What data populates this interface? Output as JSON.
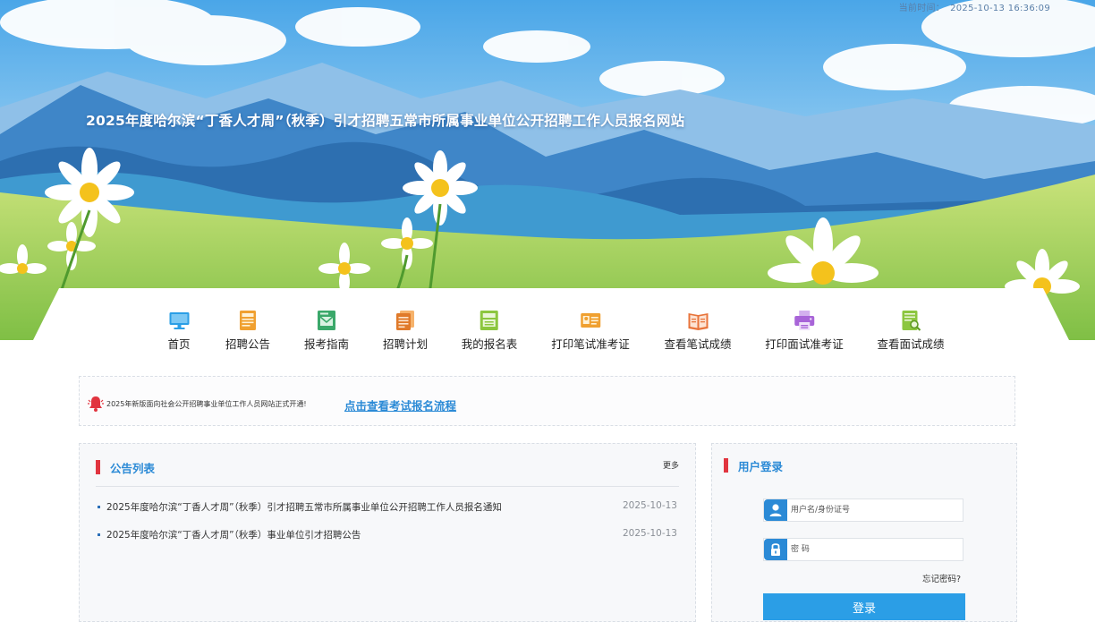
{
  "header": {
    "time_label": "当前时间：",
    "time_value": "2025-10-13 16:36:09",
    "site_title": "2025年度哈尔滨“丁香人才周”（秋季）引才招聘五常市所属事业单位公开招聘工作人员报名网站"
  },
  "nav": {
    "items": [
      {
        "label": "首页",
        "icon": "monitor-icon",
        "color": "#2b9ee6"
      },
      {
        "label": "招聘公告",
        "icon": "document-icon",
        "color": "#f0a030"
      },
      {
        "label": "报考指南",
        "icon": "mail-icon",
        "color": "#3aa86a"
      },
      {
        "label": "招聘计划",
        "icon": "files-icon",
        "color": "#e07a2a"
      },
      {
        "label": "我的报名表",
        "icon": "form-icon",
        "color": "#8cc63f"
      },
      {
        "label": "打印笔试准考证",
        "icon": "id-card-icon",
        "color": "#f0a030"
      },
      {
        "label": "查看笔试成绩",
        "icon": "book-icon",
        "color": "#e8743b"
      },
      {
        "label": "打印面试准考证",
        "icon": "printer-icon",
        "color": "#a864d8"
      },
      {
        "label": "查看面试成绩",
        "icon": "search-doc-icon",
        "color": "#8cc63f"
      }
    ]
  },
  "notice": {
    "text": "2025年新版面向社会公开招聘事业单位工作人员网站正式开通!",
    "link": "点击查看考试报名流程",
    "icon": "bell-icon"
  },
  "announcements": {
    "title": "公告列表",
    "more": "更多",
    "items": [
      {
        "title": "2025年度哈尔滨“丁香人才周”（秋季）引才招聘五常市所属事业单位公开招聘工作人员报名通知",
        "date": "2025-10-13"
      },
      {
        "title": "2025年度哈尔滨“丁香人才周”（秋季）事业单位引才招聘公告",
        "date": "2025-10-13"
      }
    ]
  },
  "login": {
    "title": "用户登录",
    "username_placeholder": "用户名/身份证号",
    "password_placeholder": "密 码",
    "forgot": "忘记密码?",
    "submit": "登录"
  },
  "colors": {
    "accent": "#2b8ad6",
    "section_bar": "#e1343f",
    "button": "#2b9ee6"
  }
}
